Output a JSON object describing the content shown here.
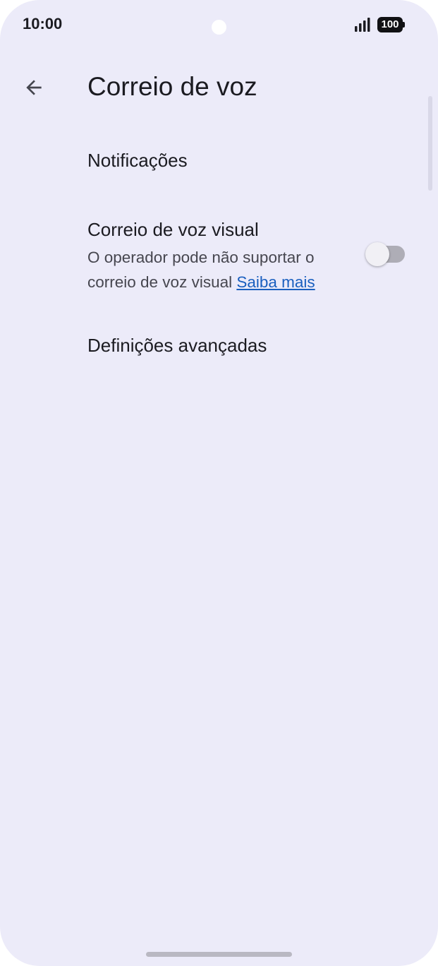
{
  "status_bar": {
    "time": "10:00",
    "battery": "100",
    "signal_icon": "signal-bars-icon",
    "battery_icon": "battery-icon"
  },
  "app_bar": {
    "back_icon": "arrow-back-icon",
    "title": "Correio de voz"
  },
  "settings": {
    "notifications": {
      "title": "Notificações"
    },
    "visual_voicemail": {
      "title": "Correio de voz visual",
      "summary": "O operador pode não suportar o correio de voz visual",
      "link": "Saiba mais",
      "toggle_on": false
    },
    "advanced": {
      "title": "Definições avançadas"
    }
  },
  "colors": {
    "background": "#ecebf9",
    "text_primary": "#1b1b21",
    "text_secondary": "#46464f",
    "link": "#1a5fbf"
  }
}
